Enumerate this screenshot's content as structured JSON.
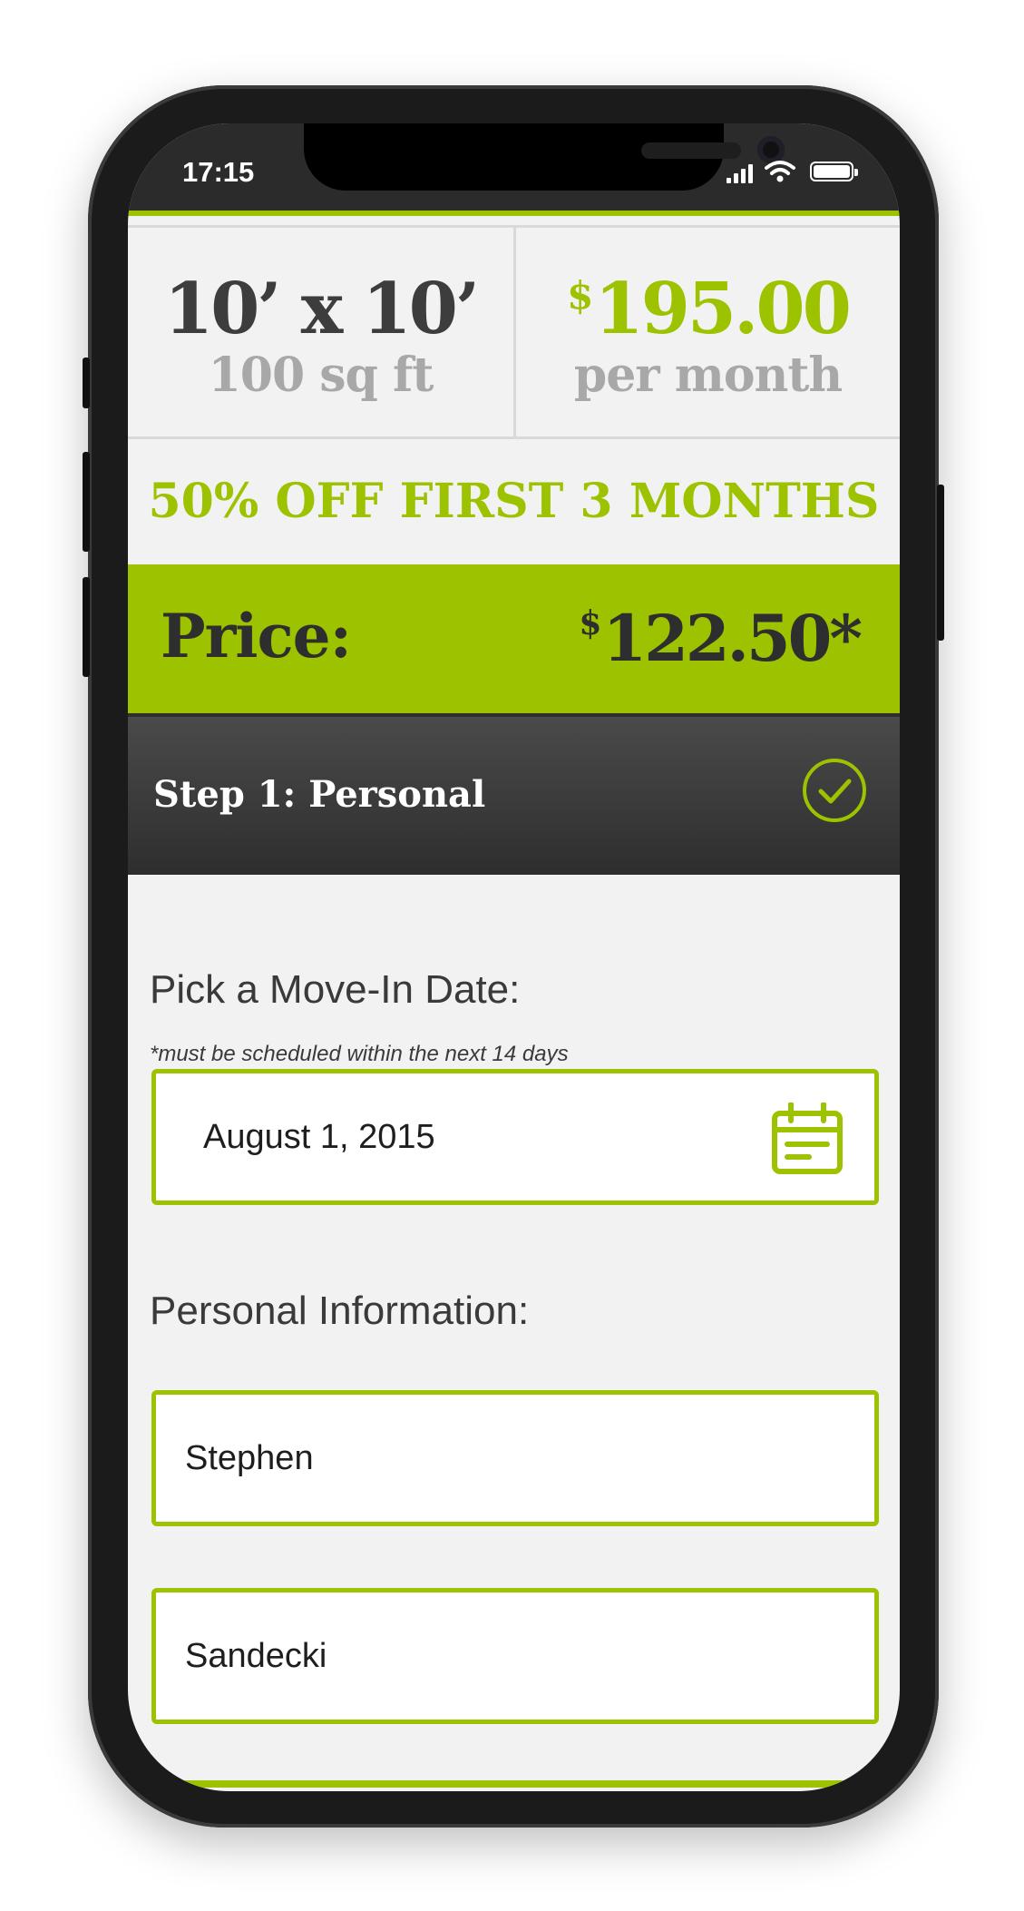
{
  "status_bar": {
    "time": "17:15"
  },
  "unit": {
    "size": "10’ x 10’",
    "area": "100 sq ft",
    "currency": "$",
    "rate": "195.00",
    "rate_period": "per month"
  },
  "promo": {
    "text": "50% OFF FIRST 3 MONTHS"
  },
  "price_bar": {
    "label": "Price:",
    "currency": "$",
    "value": "122.50*"
  },
  "step": {
    "title": "Step 1: Personal",
    "completed": true
  },
  "move_in": {
    "label": "Pick a Move-In Date:",
    "note": "*must be scheduled within the next 14 days",
    "date_value": "August 1, 2015"
  },
  "personal": {
    "label": "Personal Information:",
    "first_name": "Stephen",
    "last_name": "Sandecki"
  },
  "colors": {
    "accent": "#9cc200",
    "dark": "#2e2e2e",
    "background": "#f2f2f2"
  },
  "icons": {
    "step_status": "check-circle-icon",
    "date_picker": "calendar-icon"
  }
}
